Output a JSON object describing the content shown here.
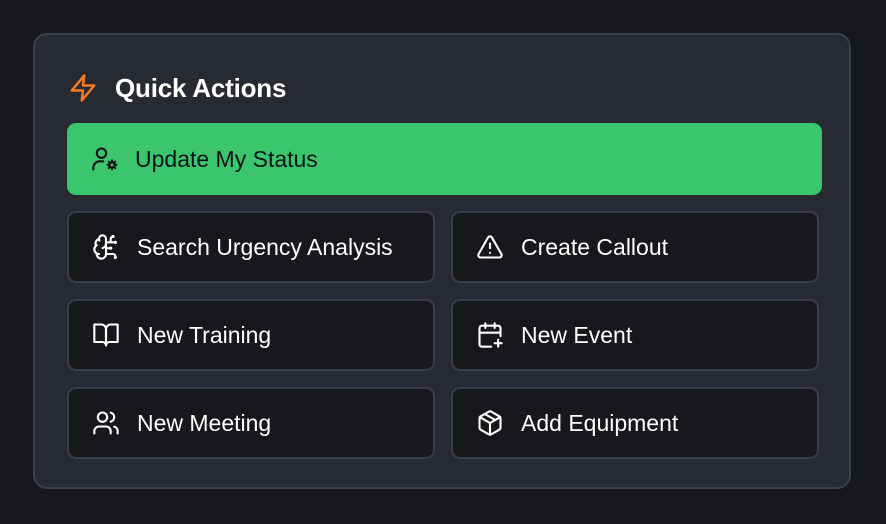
{
  "quick_actions": {
    "title": "Quick Actions",
    "accent_color": "#f47b20",
    "primary_color": "#3bc66e",
    "primary_action": {
      "label": "Update My Status",
      "icon": "user-cog-icon"
    },
    "actions": [
      {
        "label": "Search Urgency Analysis",
        "icon": "brain-icon"
      },
      {
        "label": "Create Callout",
        "icon": "alert-triangle-icon"
      },
      {
        "label": "New Training",
        "icon": "book-open-icon"
      },
      {
        "label": "New Event",
        "icon": "calendar-plus-icon"
      },
      {
        "label": "New Meeting",
        "icon": "users-icon"
      },
      {
        "label": "Add Equipment",
        "icon": "package-icon"
      }
    ]
  }
}
